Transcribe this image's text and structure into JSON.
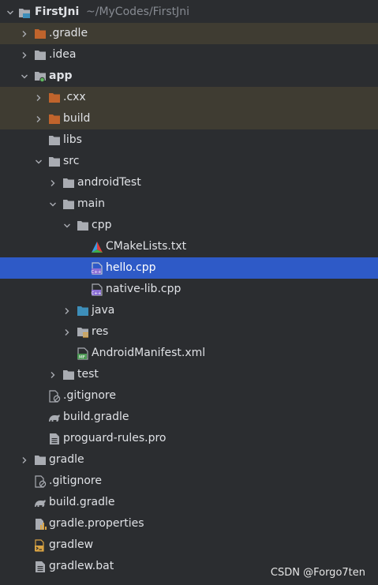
{
  "project_tree": {
    "root": {
      "name": "FirstJni",
      "path_hint": "~/MyCodes/FirstJni"
    },
    "items": [
      {
        "label": ".gradle",
        "icon": "folder-icon",
        "excluded": true
      },
      {
        "label": ".idea",
        "icon": "folder-icon"
      },
      {
        "label": "app",
        "icon": "module-folder-icon"
      },
      {
        "label": ".cxx",
        "icon": "folder-icon",
        "excluded": true
      },
      {
        "label": "build",
        "icon": "folder-icon",
        "excluded": true
      },
      {
        "label": "libs",
        "icon": "folder-icon"
      },
      {
        "label": "src",
        "icon": "folder-icon"
      },
      {
        "label": "androidTest",
        "icon": "folder-icon"
      },
      {
        "label": "main",
        "icon": "folder-icon"
      },
      {
        "label": "cpp",
        "icon": "folder-icon"
      },
      {
        "label": "CMakeLists.txt",
        "icon": "cmake-icon"
      },
      {
        "label": "hello.cpp",
        "icon": "cpp-file-icon",
        "selected": true
      },
      {
        "label": "native-lib.cpp",
        "icon": "cpp-file-icon"
      },
      {
        "label": "java",
        "icon": "source-folder-icon"
      },
      {
        "label": "res",
        "icon": "resource-folder-icon"
      },
      {
        "label": "AndroidManifest.xml",
        "icon": "manifest-icon"
      },
      {
        "label": "test",
        "icon": "folder-icon"
      },
      {
        "label": ".gitignore",
        "icon": "gitignore-icon"
      },
      {
        "label": "build.gradle",
        "icon": "gradle-icon"
      },
      {
        "label": "proguard-rules.pro",
        "icon": "text-file-icon"
      },
      {
        "label": "gradle",
        "icon": "folder-icon"
      },
      {
        "label": ".gitignore",
        "icon": "gitignore-icon"
      },
      {
        "label": "build.gradle",
        "icon": "gradle-icon"
      },
      {
        "label": "gradle.properties",
        "icon": "properties-icon"
      },
      {
        "label": "gradlew",
        "icon": "shell-script-icon"
      },
      {
        "label": "gradlew.bat",
        "icon": "text-file-icon"
      }
    ]
  },
  "watermark": "CSDN @Forgo7ten",
  "colors": {
    "background": "#2b2d30",
    "selected_row": "#2e5ac7",
    "excluded_row": "#3f3c32",
    "excluded_folder": "#c0642c",
    "folder": "#a9acb2",
    "source_folder": "#3d8eb9",
    "text": "#dfe1e5",
    "hint": "#868a91"
  }
}
